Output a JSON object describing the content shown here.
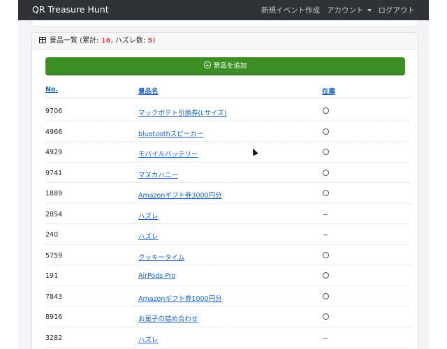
{
  "navbar": {
    "brand": "QR Treasure Hunt",
    "new_event": "新規イベント作成",
    "account": "アカウント",
    "logout": "ログアウト"
  },
  "card": {
    "title_prefix": "景品一覧 (累計: ",
    "total": "16",
    "sep": ", ハズレ数: ",
    "miss": "5",
    "suffix": ")"
  },
  "add_button": "景品を追加",
  "table": {
    "headers": {
      "no": "No.",
      "name": "景品名",
      "stock": "在庫"
    },
    "rows": [
      {
        "no": "9706",
        "name": "マックポテト引換券(Lサイズ) ",
        "stock": "○"
      },
      {
        "no": "4966",
        "name": "bluetoothスピーカー",
        "stock": "○"
      },
      {
        "no": "4929",
        "name": "モバイルバッテリー",
        "stock": "○"
      },
      {
        "no": "9741",
        "name": "マヌカハニー",
        "stock": "○"
      },
      {
        "no": "1889",
        "name": "Amazonギフト券3000円分",
        "stock": "○"
      },
      {
        "no": "2854",
        "name": "ハズレ",
        "stock": "−"
      },
      {
        "no": "240",
        "name": "ハズレ",
        "stock": "−"
      },
      {
        "no": "5759",
        "name": "クッキータイム",
        "stock": "○"
      },
      {
        "no": "191",
        "name": "AirPods Pro",
        "stock": "○"
      },
      {
        "no": "7843",
        "name": "Amazonギフト券1000円分",
        "stock": "○"
      },
      {
        "no": "8916",
        "name": "お菓子の詰め合わせ",
        "stock": "○"
      },
      {
        "no": "3282",
        "name": "ハズレ",
        "stock": "−"
      }
    ]
  },
  "colors": {
    "navbar": "#2f3237",
    "accent": "#3c8f24",
    "link": "#1a62c5",
    "count_red": "#d9534f"
  }
}
